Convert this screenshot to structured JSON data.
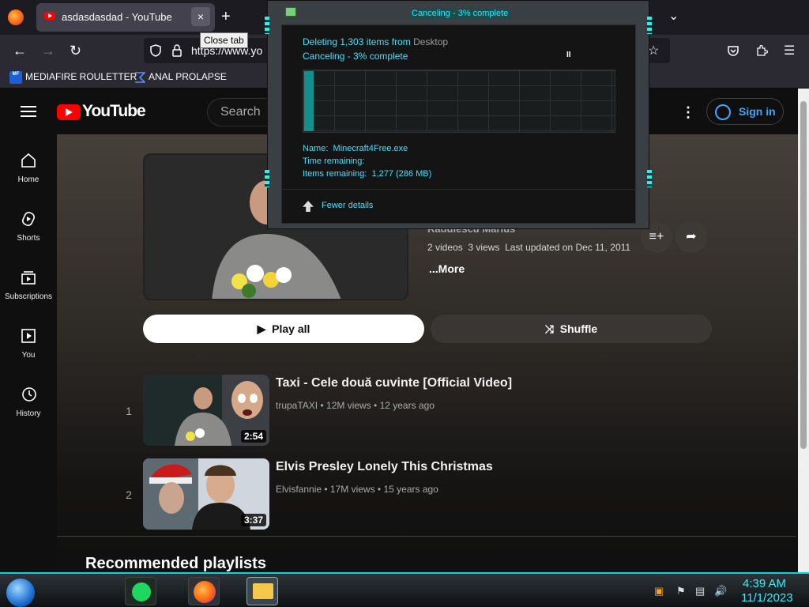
{
  "browser": {
    "tab_title": "asdasdasdad - YouTube",
    "tab_close": "×",
    "new_tab": "+",
    "tab_list": "⌄",
    "tooltip": "Close tab",
    "url": "https://www.yo",
    "bookmarks": [
      "MEDIAFIRE ROULETTER",
      "ANAL PROLAPSE"
    ]
  },
  "youtube": {
    "logo": "YouTube",
    "search_placeholder": "Search",
    "sign_in": "Sign in",
    "sidebar": [
      {
        "label": "Home",
        "icon": "home-icon"
      },
      {
        "label": "Shorts",
        "icon": "shorts-icon"
      },
      {
        "label": "Subscriptions",
        "icon": "subscriptions-icon"
      },
      {
        "label": "You",
        "icon": "you-icon"
      },
      {
        "label": "History",
        "icon": "history-icon"
      }
    ],
    "playlist": {
      "owner": "Radulescu Marius",
      "videos": "2 videos",
      "views": "3 views",
      "updated": "Last updated on Dec 11, 2011",
      "more": "...More",
      "play_all": "Play all",
      "shuffle": "Shuffle"
    },
    "videos": [
      {
        "index": "1",
        "title": "Taxi - Cele două cuvinte [Official Video]",
        "channel": "trupaTAXI",
        "views": "12M views",
        "age": "12 years ago",
        "duration": "2:54"
      },
      {
        "index": "2",
        "title": "Elvis Presley Lonely This Christmas",
        "channel": "Elvisfannie",
        "views": "17M views",
        "age": "15 years ago",
        "duration": "3:37"
      }
    ],
    "recommended_heading": "Recommended playlists"
  },
  "copy_dialog": {
    "title": "Canceling - 3% complete",
    "deleting_prefix": "Deleting 1,303 items from",
    "deleting_source": "Desktop",
    "status": "Canceling - 3% complete",
    "pause": "II",
    "progress_percent": 3,
    "name_label": "Name:",
    "name_value": "Minecraft4Free.exe",
    "time_label": "Time remaining:",
    "items_label": "Items remaining:",
    "items_value": "1,277 (286 MB)",
    "fewer_details": "Fewer details"
  },
  "taskbar": {
    "time": "4:39 AM",
    "date": "11/1/2023"
  }
}
